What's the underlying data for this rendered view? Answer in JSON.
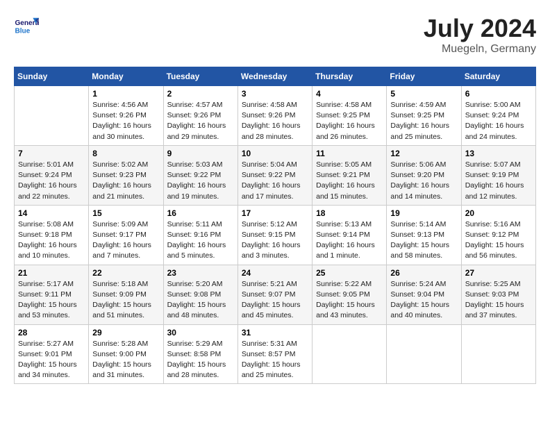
{
  "header": {
    "logo_general": "General",
    "logo_blue": "Blue",
    "month": "July 2024",
    "location": "Muegeln, Germany"
  },
  "days_of_week": [
    "Sunday",
    "Monday",
    "Tuesday",
    "Wednesday",
    "Thursday",
    "Friday",
    "Saturday"
  ],
  "weeks": [
    [
      {
        "day": null,
        "info": null
      },
      {
        "day": "1",
        "info": "Sunrise: 4:56 AM\nSunset: 9:26 PM\nDaylight: 16 hours\nand 30 minutes."
      },
      {
        "day": "2",
        "info": "Sunrise: 4:57 AM\nSunset: 9:26 PM\nDaylight: 16 hours\nand 29 minutes."
      },
      {
        "day": "3",
        "info": "Sunrise: 4:58 AM\nSunset: 9:26 PM\nDaylight: 16 hours\nand 28 minutes."
      },
      {
        "day": "4",
        "info": "Sunrise: 4:58 AM\nSunset: 9:25 PM\nDaylight: 16 hours\nand 26 minutes."
      },
      {
        "day": "5",
        "info": "Sunrise: 4:59 AM\nSunset: 9:25 PM\nDaylight: 16 hours\nand 25 minutes."
      },
      {
        "day": "6",
        "info": "Sunrise: 5:00 AM\nSunset: 9:24 PM\nDaylight: 16 hours\nand 24 minutes."
      }
    ],
    [
      {
        "day": "7",
        "info": "Sunrise: 5:01 AM\nSunset: 9:24 PM\nDaylight: 16 hours\nand 22 minutes."
      },
      {
        "day": "8",
        "info": "Sunrise: 5:02 AM\nSunset: 9:23 PM\nDaylight: 16 hours\nand 21 minutes."
      },
      {
        "day": "9",
        "info": "Sunrise: 5:03 AM\nSunset: 9:22 PM\nDaylight: 16 hours\nand 19 minutes."
      },
      {
        "day": "10",
        "info": "Sunrise: 5:04 AM\nSunset: 9:22 PM\nDaylight: 16 hours\nand 17 minutes."
      },
      {
        "day": "11",
        "info": "Sunrise: 5:05 AM\nSunset: 9:21 PM\nDaylight: 16 hours\nand 15 minutes."
      },
      {
        "day": "12",
        "info": "Sunrise: 5:06 AM\nSunset: 9:20 PM\nDaylight: 16 hours\nand 14 minutes."
      },
      {
        "day": "13",
        "info": "Sunrise: 5:07 AM\nSunset: 9:19 PM\nDaylight: 16 hours\nand 12 minutes."
      }
    ],
    [
      {
        "day": "14",
        "info": "Sunrise: 5:08 AM\nSunset: 9:18 PM\nDaylight: 16 hours\nand 10 minutes."
      },
      {
        "day": "15",
        "info": "Sunrise: 5:09 AM\nSunset: 9:17 PM\nDaylight: 16 hours\nand 7 minutes."
      },
      {
        "day": "16",
        "info": "Sunrise: 5:11 AM\nSunset: 9:16 PM\nDaylight: 16 hours\nand 5 minutes."
      },
      {
        "day": "17",
        "info": "Sunrise: 5:12 AM\nSunset: 9:15 PM\nDaylight: 16 hours\nand 3 minutes."
      },
      {
        "day": "18",
        "info": "Sunrise: 5:13 AM\nSunset: 9:14 PM\nDaylight: 16 hours\nand 1 minute."
      },
      {
        "day": "19",
        "info": "Sunrise: 5:14 AM\nSunset: 9:13 PM\nDaylight: 15 hours\nand 58 minutes."
      },
      {
        "day": "20",
        "info": "Sunrise: 5:16 AM\nSunset: 9:12 PM\nDaylight: 15 hours\nand 56 minutes."
      }
    ],
    [
      {
        "day": "21",
        "info": "Sunrise: 5:17 AM\nSunset: 9:11 PM\nDaylight: 15 hours\nand 53 minutes."
      },
      {
        "day": "22",
        "info": "Sunrise: 5:18 AM\nSunset: 9:09 PM\nDaylight: 15 hours\nand 51 minutes."
      },
      {
        "day": "23",
        "info": "Sunrise: 5:20 AM\nSunset: 9:08 PM\nDaylight: 15 hours\nand 48 minutes."
      },
      {
        "day": "24",
        "info": "Sunrise: 5:21 AM\nSunset: 9:07 PM\nDaylight: 15 hours\nand 45 minutes."
      },
      {
        "day": "25",
        "info": "Sunrise: 5:22 AM\nSunset: 9:05 PM\nDaylight: 15 hours\nand 43 minutes."
      },
      {
        "day": "26",
        "info": "Sunrise: 5:24 AM\nSunset: 9:04 PM\nDaylight: 15 hours\nand 40 minutes."
      },
      {
        "day": "27",
        "info": "Sunrise: 5:25 AM\nSunset: 9:03 PM\nDaylight: 15 hours\nand 37 minutes."
      }
    ],
    [
      {
        "day": "28",
        "info": "Sunrise: 5:27 AM\nSunset: 9:01 PM\nDaylight: 15 hours\nand 34 minutes."
      },
      {
        "day": "29",
        "info": "Sunrise: 5:28 AM\nSunset: 9:00 PM\nDaylight: 15 hours\nand 31 minutes."
      },
      {
        "day": "30",
        "info": "Sunrise: 5:29 AM\nSunset: 8:58 PM\nDaylight: 15 hours\nand 28 minutes."
      },
      {
        "day": "31",
        "info": "Sunrise: 5:31 AM\nSunset: 8:57 PM\nDaylight: 15 hours\nand 25 minutes."
      },
      {
        "day": null,
        "info": null
      },
      {
        "day": null,
        "info": null
      },
      {
        "day": null,
        "info": null
      }
    ]
  ]
}
